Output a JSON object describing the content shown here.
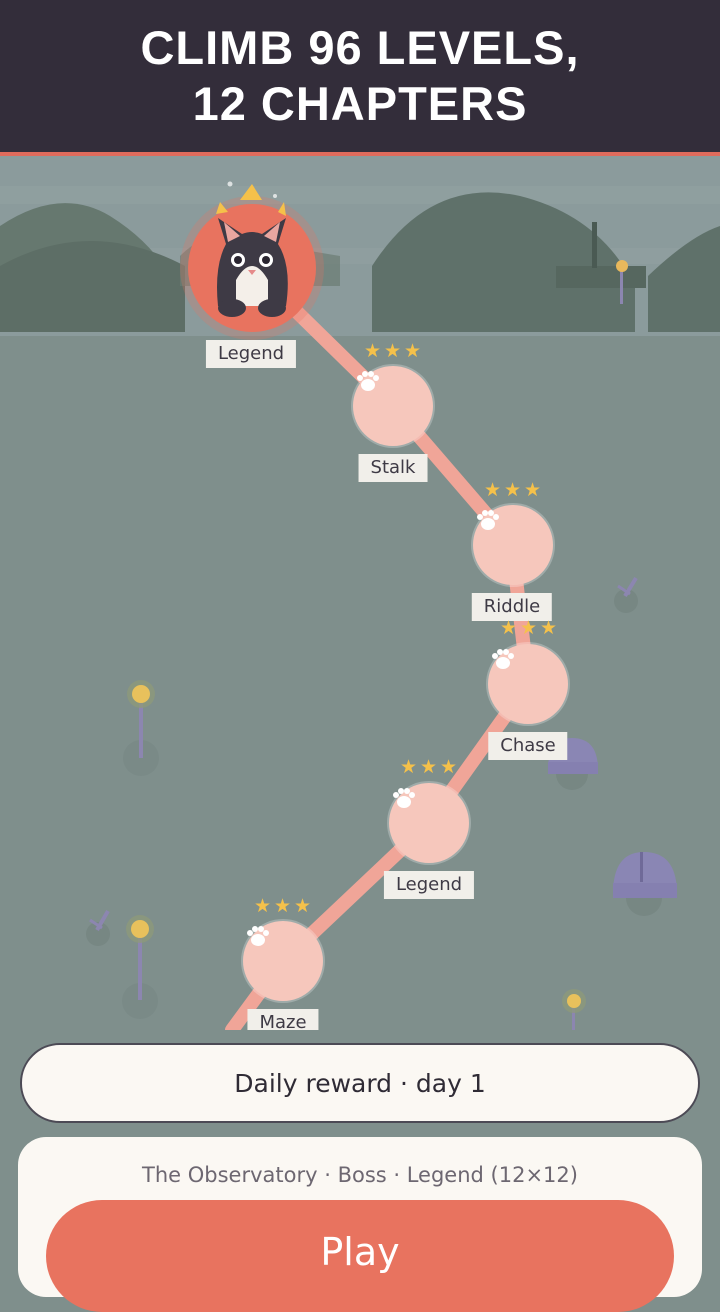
{
  "header": {
    "line1": "CLIMB 96 LEVELS,",
    "line2": "12 CHAPTERS"
  },
  "map": {
    "current_level": {
      "label": "Legend",
      "avatar": "cat-avatar"
    },
    "levels": [
      {
        "label": "Stalk",
        "stars": "★★★",
        "icon": "paw-icon"
      },
      {
        "label": "Riddle",
        "stars": "★★★",
        "icon": "paw-icon"
      },
      {
        "label": "Chase",
        "stars": "★★★",
        "icon": "paw-icon"
      },
      {
        "label": "Legend",
        "stars": "★★★",
        "icon": "paw-icon"
      },
      {
        "label": "Maze",
        "stars": "★★★",
        "icon": "paw-icon"
      }
    ]
  },
  "daily_reward": {
    "label": "Daily reward · day 1"
  },
  "next_level": {
    "subtitle": "The Observatory · Boss · Legend (12×12)",
    "play_label": "Play"
  },
  "colors": {
    "header_bg": "#332d3a",
    "accent": "#e8735f",
    "path": "#f0a598",
    "node": "#f6c7bc",
    "star": "#f5c14a",
    "map_bg": "#7f8f8c"
  }
}
